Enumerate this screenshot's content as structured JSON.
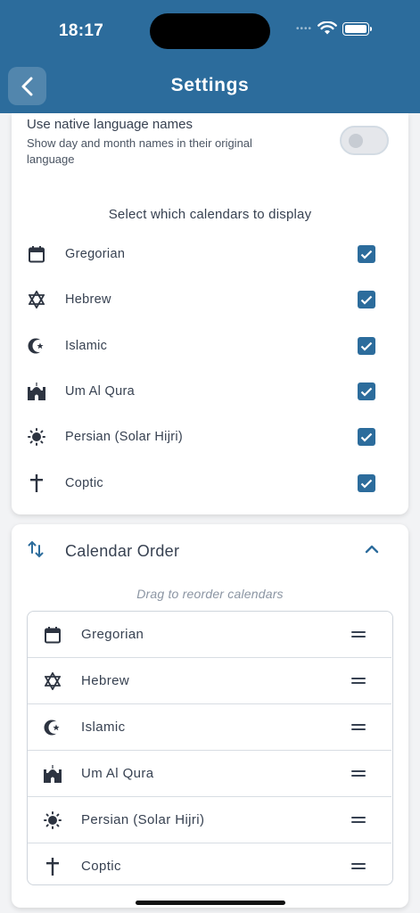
{
  "status_bar": {
    "time": "18:17"
  },
  "header": {
    "title": "Settings"
  },
  "native_language": {
    "title": "Use native language names",
    "description": "Show day and month names in their original language",
    "enabled": false
  },
  "calendars_section": {
    "heading": "Select which calendars to display",
    "items": [
      {
        "label": "Gregorian",
        "icon": "calendar-icon",
        "checked": true
      },
      {
        "label": "Hebrew",
        "icon": "star-of-david-icon",
        "checked": true
      },
      {
        "label": "Islamic",
        "icon": "crescent-star-icon",
        "checked": true
      },
      {
        "label": "Um Al Qura",
        "icon": "mosque-icon",
        "checked": true
      },
      {
        "label": "Persian (Solar Hijri)",
        "icon": "sun-icon",
        "checked": true
      },
      {
        "label": "Coptic",
        "icon": "cross-icon",
        "checked": true
      }
    ]
  },
  "calendar_order": {
    "title": "Calendar Order",
    "hint": "Drag to reorder calendars",
    "items": [
      {
        "label": "Gregorian",
        "icon": "calendar-icon"
      },
      {
        "label": "Hebrew",
        "icon": "star-of-david-icon"
      },
      {
        "label": "Islamic",
        "icon": "crescent-star-icon"
      },
      {
        "label": "Um Al Qura",
        "icon": "mosque-icon"
      },
      {
        "label": "Persian (Solar Hijri)",
        "icon": "sun-icon"
      },
      {
        "label": "Coptic",
        "icon": "cross-icon"
      }
    ]
  },
  "colors": {
    "primary": "#2c6c9c",
    "text": "#374151",
    "background": "#f2f3f5"
  }
}
